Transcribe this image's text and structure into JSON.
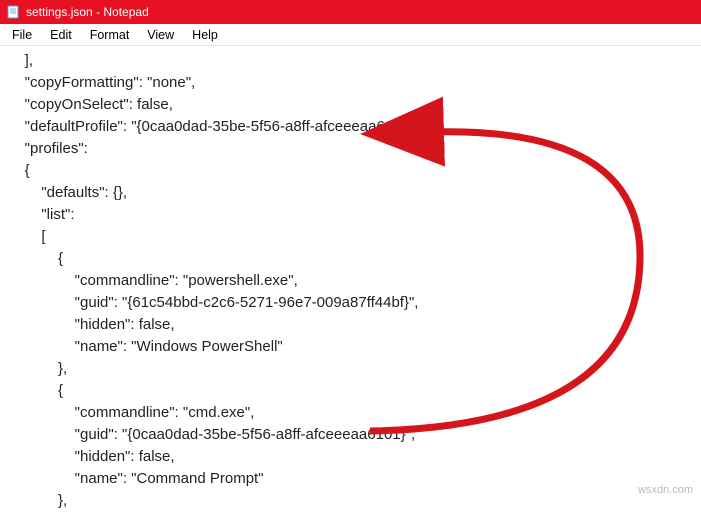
{
  "window": {
    "title": "settings.json - Notepad"
  },
  "menu": {
    "file": "File",
    "edit": "Edit",
    "format": "Format",
    "view": "View",
    "help": "Help"
  },
  "editor": {
    "lines": [
      "    ],",
      "    \"copyFormatting\": \"none\",",
      "    \"copyOnSelect\": false,",
      "    \"defaultProfile\": \"{0caa0dad-35be-5f56-a8ff-afceeeaa6101}\",",
      "    \"profiles\":",
      "    {",
      "        \"defaults\": {},",
      "        \"list\":",
      "        [",
      "            {",
      "                \"commandline\": \"powershell.exe\",",
      "                \"guid\": \"{61c54bbd-c2c6-5271-96e7-009a87ff44bf}\",",
      "                \"hidden\": false,",
      "                \"name\": \"Windows PowerShell\"",
      "            },",
      "            {",
      "                \"commandline\": \"cmd.exe\",",
      "                \"guid\": \"{0caa0dad-35be-5f56-a8ff-afceeeaa6101}\",",
      "                \"hidden\": false,",
      "                \"name\": \"Command Prompt\"",
      "            },"
    ]
  },
  "watermark": "wsxdn.com"
}
